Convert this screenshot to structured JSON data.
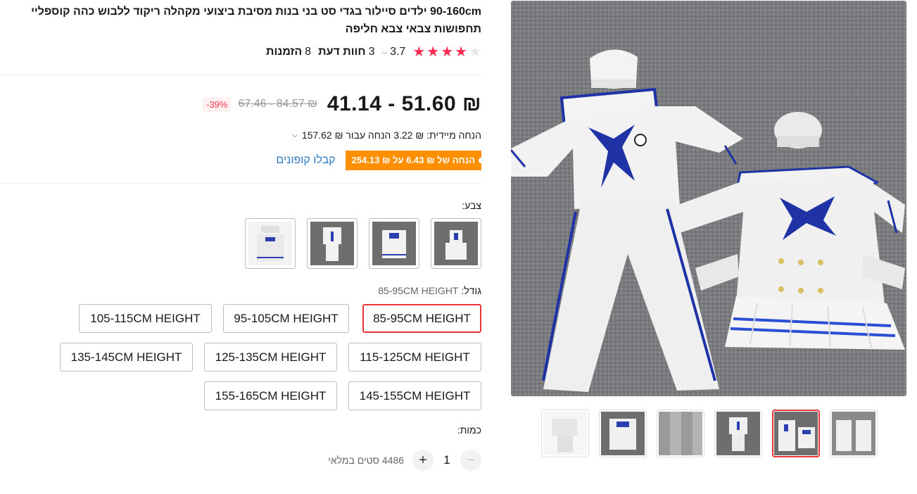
{
  "product": {
    "title": "90-160cm ילדים סיילור בגדי סט בני בנות מסיבת ביצועי מקהלה ריקוד ללבוש כהה קוספליי תחפושות צבאי צבא חליפה",
    "rating": {
      "value": "3.7",
      "filled_stars": 4,
      "total_stars": 5,
      "reviews_count": "3",
      "reviews_label": "חוות דעת",
      "orders_count": "8",
      "orders_label": "הזמנות"
    }
  },
  "price": {
    "current": "₪ 51.60 - 41.14",
    "original": "₪ 84.57 - 67.46",
    "discount": "-39%"
  },
  "instant_discount": {
    "text": "הנחה מיידית: ₪ 3.22 הנחה עבור ₪ 157.62"
  },
  "coupon": {
    "badge": "הנחה של ₪ 6.43 על ₪ 254.13",
    "link": "קבלו קופונים"
  },
  "color": {
    "label": "צבע:",
    "options": [
      "boy-set",
      "girl-set",
      "boy-dress-set",
      "girl-dress-set"
    ]
  },
  "size": {
    "label": "גודל:",
    "selected_value": "85-95CM HEIGHT",
    "options": [
      "85-95CM HEIGHT",
      "95-105CM HEIGHT",
      "105-115CM HEIGHT",
      "115-125CM HEIGHT",
      "125-135CM HEIGHT",
      "135-145CM HEIGHT",
      "145-155CM HEIGHT",
      "155-165CM HEIGHT"
    ]
  },
  "quantity": {
    "label": "כמות:",
    "value": "1",
    "plus": "+",
    "minus": "−",
    "stock": "4486 סטים במלאי"
  },
  "gallery": {
    "selected_index": 4,
    "thumb_count": 6
  },
  "icons": {
    "star": "star-icon",
    "chevron": "chevron-down-icon",
    "plus": "plus-icon",
    "minus": "minus-icon"
  },
  "colors": {
    "accent_red": "#e8353a",
    "star_red": "#fe2c55",
    "coupon_orange": "#fd8f00",
    "link_blue": "#2e7bc5",
    "uniform_blue": "#2c3fb0"
  }
}
